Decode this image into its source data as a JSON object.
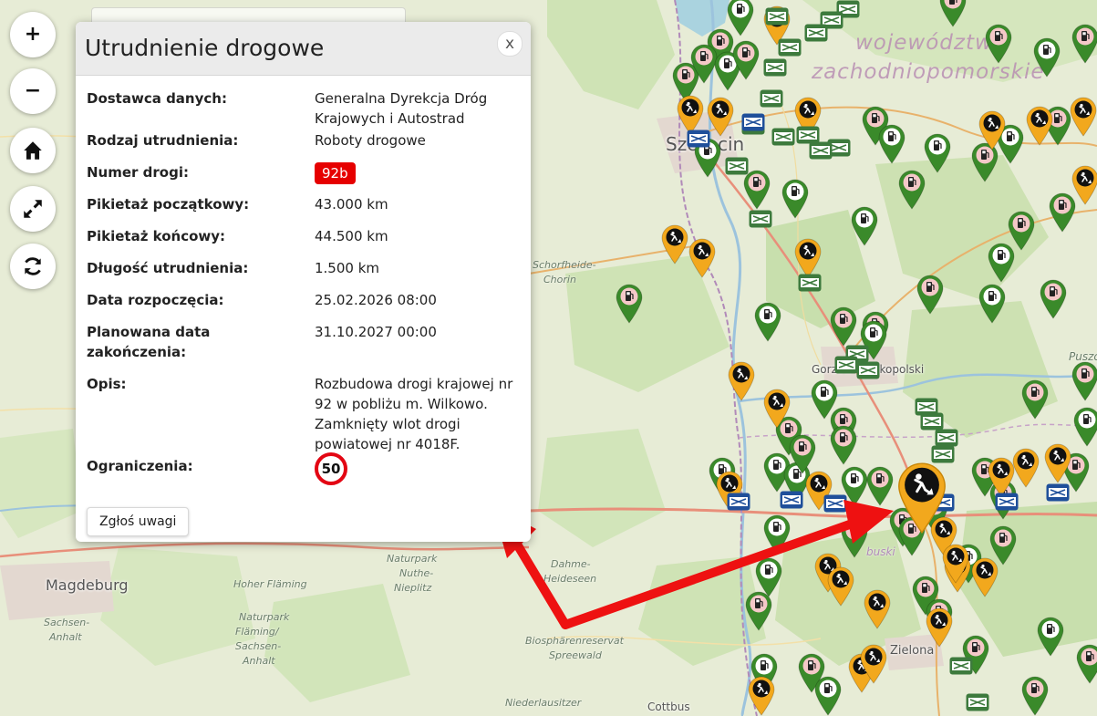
{
  "map": {
    "labels": {
      "region_line1": "województwo",
      "region_line2": "zachodniopomorskie",
      "szczecin": "Szczecin",
      "gorzow": "Gorzów Wielkopolski",
      "magdeburg": "Magdeburg",
      "sachsen_anhalt_1": "Sachsen-",
      "sachsen_anhalt_2": "Anhalt",
      "hoher_flaming": "Hoher Fläming",
      "naturpark_1": "Naturpark",
      "naturpark_2": "Nuthe-",
      "naturpark_3": "Nieplitz",
      "naturpark_b1": "Naturpark",
      "naturpark_b2": "Fläming/",
      "naturpark_b3": "Sachsen-",
      "naturpark_b4": "Anhalt",
      "dahme_1": "Dahme-",
      "dahme_2": "Heideseen",
      "biosphere_1": "Biosphärenreservat",
      "biosphere_2": "Spreewald",
      "niederlausitz": "Niederlausitzer",
      "cottbus": "Cottbus",
      "zielona": "Zielona",
      "schorfheide_1": "Schorfheide-",
      "schorfheide_2": "Chorin",
      "buski": "buski",
      "puszcza": "Puszc"
    },
    "colors": {
      "green_marker": "#3a8a2a",
      "orange_marker": "#f2a81d",
      "closure_green": "#3d7a3d",
      "closure_blue": "#1f4f9a",
      "arrow": "#ee1111"
    },
    "icons": {
      "ev": "ev-charger-icon",
      "works": "roadworks-icon",
      "closure": "road-closure-icon"
    }
  },
  "controls": {
    "zoom_in": "+",
    "zoom_out": "−",
    "home_icon": "home-icon",
    "fullscreen_icon": "expand-icon",
    "refresh_icon": "refresh-icon"
  },
  "popup": {
    "title": "Utrudnienie drogowe",
    "close": "x",
    "rows": [
      {
        "label": "Dostawca danych:",
        "value": "Generalna Dyrekcja Dróg Krajowych i Autostrad"
      },
      {
        "label": "Rodzaj utrudnienia:",
        "value": "Roboty drogowe"
      },
      {
        "label": "Numer drogi:",
        "value": "92b"
      },
      {
        "label": "Pikietaż początkowy:",
        "value": "43.000 km"
      },
      {
        "label": "Pikietaż końcowy:",
        "value": "44.500 km"
      },
      {
        "label": "Długość utrudnienia:",
        "value": "1.500 km"
      },
      {
        "label": "Data rozpoczęcia:",
        "value": "25.02.2026 08:00"
      },
      {
        "label": "Planowana data zakończenia:",
        "value": "31.10.2027 00:00"
      },
      {
        "label": "Opis:",
        "value": "Rozbudowa drogi krajowej nr 92 w pobliżu m. Wilkowo. Zamknięty wlot drogi powiatowej nr 4018F."
      },
      {
        "label": "Ograniczenia:",
        "value": "50"
      }
    ],
    "report_button": "Zgłoś uwagi"
  }
}
